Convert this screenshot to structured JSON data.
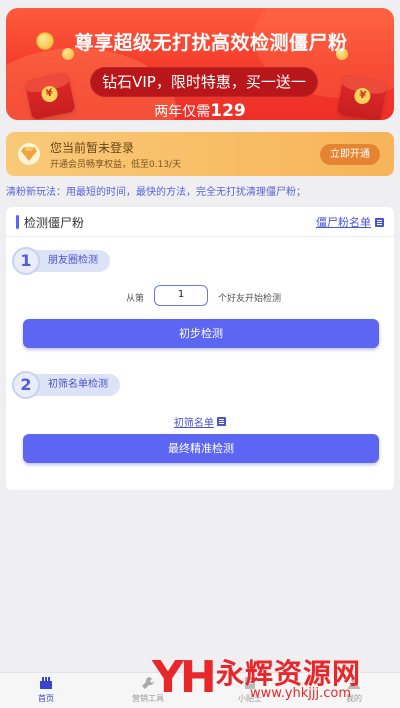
{
  "banner": {
    "title": "尊享超级无打扰高效检测僵尸粉",
    "vip_text": "钻石VIP，限时特惠，买一送一",
    "price_prefix": "两年仅需",
    "price_value": "129"
  },
  "login_card": {
    "title": "您当前暂未登录",
    "subtitle": "开通会员畅享权益，低至0.13/天",
    "button": "立即开通"
  },
  "tip": "清粉新玩法：用最短的时间，最快的方法，完全无打扰清理僵尸粉；",
  "card": {
    "title": "检测僵尸粉",
    "list_link": "僵尸粉名单",
    "step1": {
      "num": "1",
      "label": "朋友圈检测"
    },
    "from_label": "从第",
    "from_value": "1",
    "after_label": "个好友开始检测",
    "btn1": "初步检测",
    "step2": {
      "num": "2",
      "label": "初筛名单检测"
    },
    "screen_link": "初筛名单",
    "btn2": "最终精准检测"
  },
  "nav": {
    "items": [
      {
        "label": "首页",
        "icon": "home-icon"
      },
      {
        "label": "营销工具",
        "icon": "wrench-icon"
      },
      {
        "label": "小贴士",
        "icon": "tips-icon"
      },
      {
        "label": "我的",
        "icon": "profile-icon"
      }
    ]
  },
  "watermark": {
    "logo": "YH",
    "text": "永辉资源网",
    "url": "www.yhkjjj.com"
  },
  "colors": {
    "accent": "#5d66f2",
    "banner_red": "#f43b2c",
    "gold": "#f7b458"
  }
}
